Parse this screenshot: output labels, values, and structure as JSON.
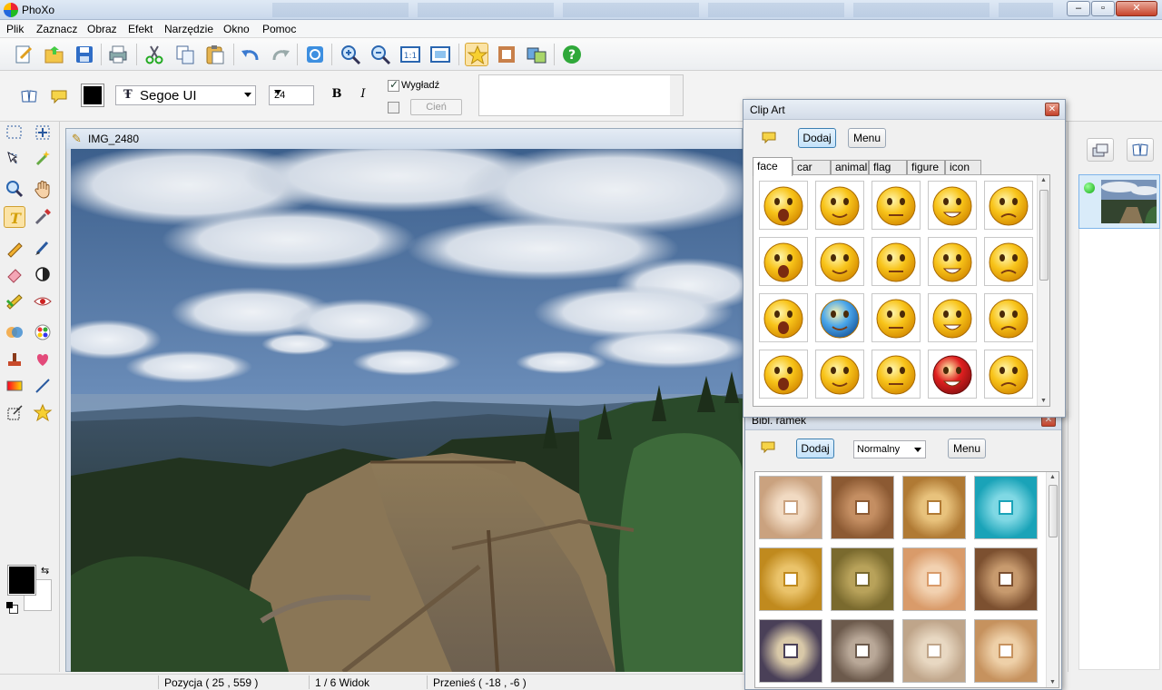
{
  "app": {
    "title": "PhoXo"
  },
  "menu": [
    "Plik",
    "Zaznacz",
    "Obraz",
    "Efekt",
    "Narzędzie",
    "Okno",
    "Pomoc"
  ],
  "toolbar": {
    "items": [
      "new-document-icon",
      "open-folder-icon",
      "save-icon",
      "print-icon",
      "cut-icon",
      "copy-icon",
      "paste-icon",
      "undo-icon",
      "redo-icon",
      "refresh-icon",
      "zoom-in-icon",
      "zoom-out-icon",
      "actual-size-icon",
      "fit-window-icon",
      "clipart-star-icon",
      "frame-icon",
      "thumbnails-icon",
      "help-icon"
    ],
    "pressed": "clipart-star-icon"
  },
  "text_options": {
    "font_name": "Segoe UI",
    "font_prefix": "Ŧ",
    "font_size": "24",
    "bold_label": "B",
    "italic_label": "I",
    "smooth_label": "Wygładź",
    "smooth_checked": true,
    "shadow_label": "Cień",
    "text_color": "#000000"
  },
  "image_window": {
    "title": "IMG_2480"
  },
  "status": {
    "position": "Pozycja ( 25 , 559 )",
    "view": "1 / 6 Widok",
    "move": "Przenieś ( -18 , -6 )"
  },
  "clipart": {
    "title": "Clip Art",
    "add_label": "Dodaj",
    "menu_label": "Menu",
    "tabs": [
      "face",
      "car",
      "animal",
      "flag",
      "figure",
      "icon"
    ],
    "active_tab": "face",
    "faces": [
      "shocked-face",
      "dizzy-face",
      "sleepy-face",
      "hurt-face",
      "confused-face",
      "love-face",
      "cool-face",
      "bruised-face",
      "grin-face",
      "annoyed-face",
      "angry-face",
      "frozen-face",
      "swearing-face",
      "crying-face",
      "sad-face",
      "scared-face",
      "drooling-face",
      "laughing-face",
      "devil-face",
      "party-face"
    ]
  },
  "frames": {
    "title": "Bibl. ramek",
    "add_label": "Dodaj",
    "mode_value": "Normalny",
    "menu_label": "Menu",
    "swatches": [
      {
        "outer": "#caa27f",
        "inner": "#f1dac2"
      },
      {
        "outer": "#8c5a33",
        "inner": "#c48e62"
      },
      {
        "outer": "#b07a34",
        "inner": "#e8c27c"
      },
      {
        "outer": "#1aa3b8",
        "inner": "#7fd8e4"
      },
      {
        "outer": "#c08a1e",
        "inner": "#eac36a"
      },
      {
        "outer": "#7a6a2e",
        "inner": "#b8a25a"
      },
      {
        "outer": "#d99b6a",
        "inner": "#f2d1b0"
      },
      {
        "outer": "#7c5030",
        "inner": "#c79a6e"
      },
      {
        "outer": "#4a4058",
        "inner": "#d8c8a8"
      },
      {
        "outer": "#6c5a4c",
        "inner": "#b9a898"
      },
      {
        "outer": "#bfa58a",
        "inner": "#e8d8c2"
      },
      {
        "outer": "#c6925e",
        "inner": "#eed0a8"
      }
    ]
  },
  "colors": {
    "accent": "#3c7fb1",
    "pressed": "#fbe3a5"
  }
}
